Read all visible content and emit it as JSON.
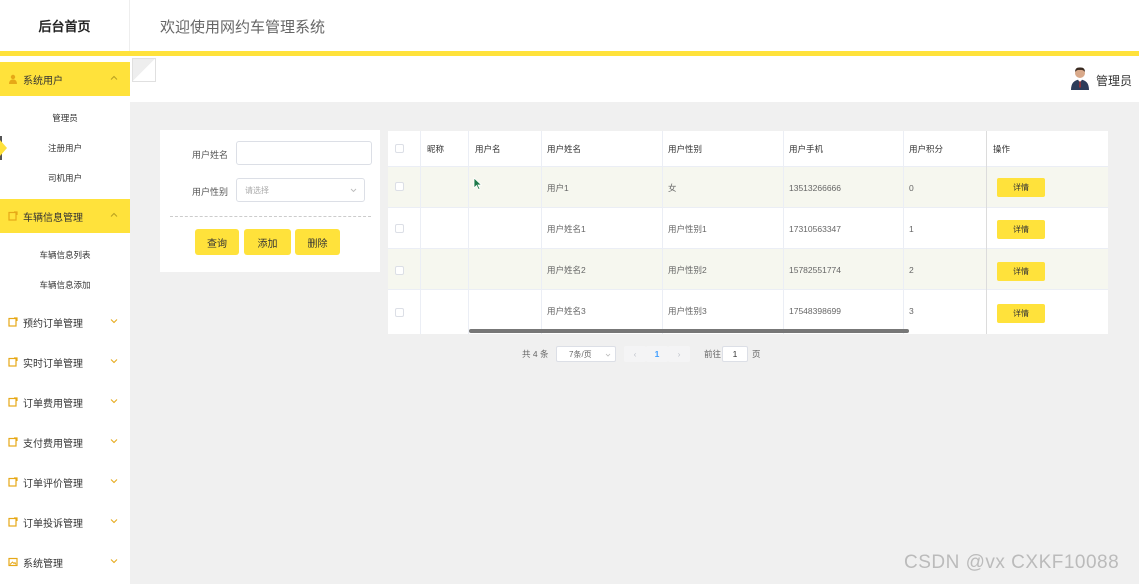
{
  "header": {
    "brand": "后台首页",
    "title": "欢迎使用网约车管理系统"
  },
  "user": {
    "name": "管理员"
  },
  "sidebar": {
    "menus": [
      {
        "label": "系统用户",
        "icon": "user-icon",
        "active": true,
        "subs": [
          "管理员",
          "注册用户",
          "司机用户"
        ]
      },
      {
        "label": "车辆信息管理",
        "icon": "document-icon",
        "active": true,
        "subs": [
          "车辆信息列表",
          "车辆信息添加"
        ]
      },
      {
        "label": "预约订单管理",
        "icon": "document-icon",
        "active": false
      },
      {
        "label": "实时订单管理",
        "icon": "document-icon",
        "active": false
      },
      {
        "label": "订单费用管理",
        "icon": "document-icon",
        "active": false
      },
      {
        "label": "支付费用管理",
        "icon": "document-icon",
        "active": false
      },
      {
        "label": "订单评价管理",
        "icon": "document-icon",
        "active": false
      },
      {
        "label": "订单投诉管理",
        "icon": "document-icon",
        "active": false
      },
      {
        "label": "系统管理",
        "icon": "image-icon",
        "active": false
      }
    ]
  },
  "search": {
    "name_label": "用户姓名",
    "name_value": "",
    "gender_label": "用户性别",
    "gender_placeholder": "请选择",
    "buttons": {
      "query": "查询",
      "add": "添加",
      "delete": "删除"
    }
  },
  "table": {
    "headers": [
      "昵称",
      "用户名",
      "用户姓名",
      "用户性别",
      "用户手机",
      "用户积分",
      "操作"
    ],
    "rows": [
      {
        "nickname": "",
        "username": "",
        "realname": "用户1",
        "gender": "女",
        "phone": "13513266666",
        "points": "0"
      },
      {
        "nickname": "",
        "username": "",
        "realname": "用户姓名1",
        "gender": "用户性别1",
        "phone": "17310563347",
        "points": "1"
      },
      {
        "nickname": "",
        "username": "",
        "realname": "用户姓名2",
        "gender": "用户性别2",
        "phone": "15782551774",
        "points": "2"
      },
      {
        "nickname": "",
        "username": "",
        "realname": "用户姓名3",
        "gender": "用户性别3",
        "phone": "17548398699",
        "points": "3"
      }
    ],
    "detail_label": "详情"
  },
  "pagination": {
    "total": "共 4 条",
    "page_size": "7条/页",
    "prev": "‹",
    "current_page": "1",
    "next": "›",
    "goto_prefix": "前往",
    "goto_value": "1",
    "goto_suffix": "页"
  },
  "watermark": "CSDN @vx  CXKF10088",
  "colors": {
    "accent": "#ffe23b",
    "stripe": "#f6f7ef"
  }
}
